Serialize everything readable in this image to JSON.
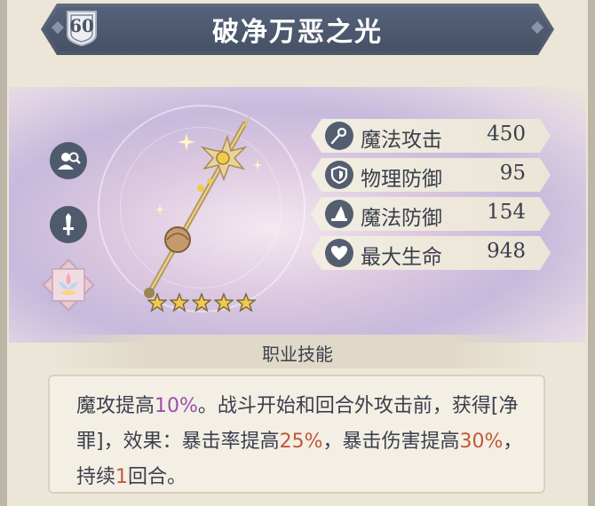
{
  "item": {
    "level": "60",
    "name": "破净万恶之光",
    "stars": 5
  },
  "side_buttons": [
    {
      "name": "inspect-character-icon"
    },
    {
      "name": "weapon-type-icon"
    },
    {
      "name": "job-emblem-icon"
    }
  ],
  "stats": [
    {
      "icon": "magic-wand-icon",
      "label": "魔法攻击",
      "value": "450"
    },
    {
      "icon": "shield-icon",
      "label": "物理防御",
      "value": "95"
    },
    {
      "icon": "wizard-hat-icon",
      "label": "魔法防御",
      "value": "154"
    },
    {
      "icon": "heart-icon",
      "label": "最大生命",
      "value": "948"
    }
  ],
  "skill": {
    "title": "职业技能",
    "segments": [
      {
        "text": "魔攻提高",
        "style": "normal"
      },
      {
        "text": "10%",
        "style": "purple"
      },
      {
        "text": "。战斗开始和回合外攻击前，获得[净罪]，效果：暴击率提高",
        "style": "normal"
      },
      {
        "text": "25%",
        "style": "red"
      },
      {
        "text": "，暴击伤害提高",
        "style": "normal"
      },
      {
        "text": "30%",
        "style": "red"
      },
      {
        "text": "，持续",
        "style": "normal"
      },
      {
        "text": "1",
        "style": "red"
      },
      {
        "text": "回合。",
        "style": "normal"
      }
    ]
  },
  "colors": {
    "header_bg": "#4d5868",
    "panel_bg": "#ece6d8",
    "accent_purple": "#9b4fae",
    "accent_red": "#c0583c",
    "star_gold": "#f2c94c"
  }
}
